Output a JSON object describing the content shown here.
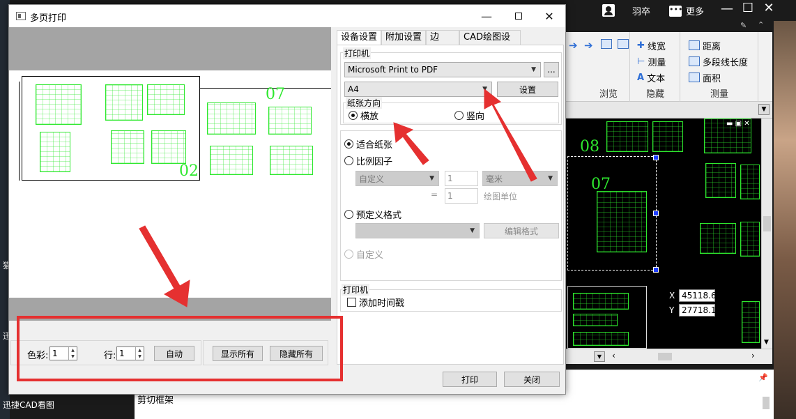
{
  "desktop": {
    "left_label_1": "猫",
    "left_label_2": "迅",
    "taskbar_label": "迅捷CAD看图"
  },
  "cad_app": {
    "user_name": "羽卒",
    "more_label": "更多",
    "ribbon": {
      "groups": [
        {
          "caption": "浏览",
          "items": []
        },
        {
          "caption": "隐藏",
          "items": [
            {
              "label": "线宽"
            },
            {
              "label": "测量"
            },
            {
              "label": "文本"
            }
          ]
        },
        {
          "caption": "测量",
          "items": [
            {
              "label": "距离"
            },
            {
              "label": "多段线长度"
            },
            {
              "label": "面积"
            }
          ]
        }
      ]
    },
    "drawing_numbers": [
      "08",
      "07"
    ],
    "coords": {
      "x_label": "X",
      "x_value": "45118.62",
      "y_label": "Y",
      "y_value": "27718.18"
    },
    "command_line_text": "剪切框架"
  },
  "dialog": {
    "title": "多页打印",
    "preview": {
      "sheet_numbers": [
        "02",
        "07"
      ]
    },
    "controls": {
      "color_label": "色彩:",
      "color_value": "1",
      "row_label": "行:",
      "row_value": "1",
      "auto_button": "自动",
      "show_all_button": "显示所有",
      "hide_all_button": "隐藏所有"
    },
    "tabs": [
      "设备设置",
      "附加设置",
      "边",
      "CAD绘图设置"
    ],
    "active_tab": "设备设置",
    "printer_group": {
      "title": "打印机",
      "printer_name": "Microsoft Print to PDF",
      "browse_button": "...",
      "paper_size": "A4",
      "settings_button": "设置"
    },
    "orientation_group": {
      "title": "纸张方向",
      "landscape": "横放",
      "portrait": "竖向",
      "selected": "landscape"
    },
    "scale": {
      "fit_paper": "适合纸张",
      "scale_factor": "比例因子",
      "unit_combo": "自定义",
      "factor_value_1": "1",
      "unit_mm": "毫米",
      "equals": "=",
      "factor_value_2": "1",
      "drawing_unit": "绘图单位",
      "predefined_format": "预定义格式",
      "edit_format_button": "编辑格式",
      "custom": "自定义",
      "selected": "fit_paper"
    },
    "stamp_group": {
      "title": "打印机",
      "add_timestamp": "添加时间戳",
      "checked": false
    },
    "print_button": "打印",
    "close_button": "关闭"
  },
  "colors": {
    "annotation_red": "#e53030",
    "cad_green": "#2ee82e",
    "cad_background": "#000000"
  }
}
